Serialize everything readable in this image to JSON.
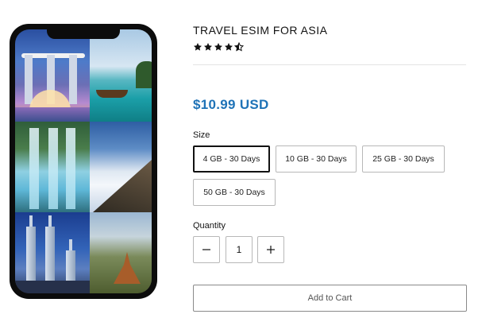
{
  "product": {
    "title": "TRAVEL ESIM FOR ASIA",
    "rating_stars": 4.5,
    "rating_max": 5,
    "price": "$10.99 USD",
    "price_color": "#1f73b7"
  },
  "gallery": {
    "tiles": [
      "singapore-skyline-photo",
      "thai-beach-photo",
      "waterfall-photo",
      "clouds-mountain-photo",
      "petronas-towers-photo",
      "bagan-pagodas-photo"
    ]
  },
  "size": {
    "label": "Size",
    "options": [
      "4 GB - 30 Days",
      "10 GB - 30 Days",
      "25 GB - 30 Days",
      "50 GB - 30 Days"
    ],
    "selected_index": 0
  },
  "quantity": {
    "label": "Quantity",
    "value": "1",
    "decrease_icon": "minus-icon",
    "increase_icon": "plus-icon"
  },
  "actions": {
    "add_to_cart": "Add to Cart"
  }
}
